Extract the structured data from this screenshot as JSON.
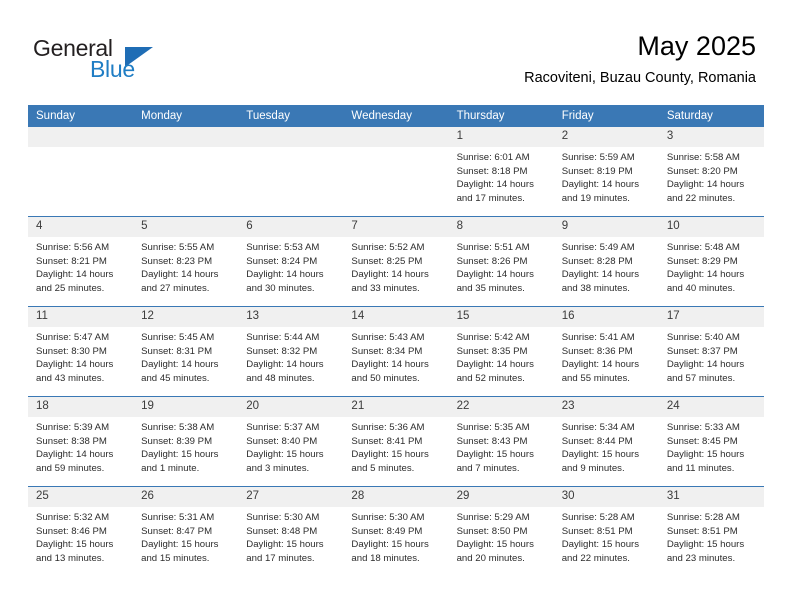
{
  "brand": {
    "name_top": "General",
    "name_bottom": "Blue",
    "accent_color": "#1f7dc4",
    "triangle_color": "#1f6db5"
  },
  "header": {
    "month_title": "May 2025",
    "location": "Racoviteni, Buzau County, Romania"
  },
  "calendar": {
    "header_bg": "#3a78b5",
    "header_text_color": "#ffffff",
    "daynum_bg": "#f0f0f0",
    "weekday_headers": [
      "Sunday",
      "Monday",
      "Tuesday",
      "Wednesday",
      "Thursday",
      "Friday",
      "Saturday"
    ],
    "weeks": [
      [
        {
          "day": "",
          "empty": true
        },
        {
          "day": "",
          "empty": true
        },
        {
          "day": "",
          "empty": true
        },
        {
          "day": "",
          "empty": true
        },
        {
          "day": "1",
          "sunrise": "Sunrise: 6:01 AM",
          "sunset": "Sunset: 8:18 PM",
          "daylight_line1": "Daylight: 14 hours",
          "daylight_line2": "and 17 minutes."
        },
        {
          "day": "2",
          "sunrise": "Sunrise: 5:59 AM",
          "sunset": "Sunset: 8:19 PM",
          "daylight_line1": "Daylight: 14 hours",
          "daylight_line2": "and 19 minutes."
        },
        {
          "day": "3",
          "sunrise": "Sunrise: 5:58 AM",
          "sunset": "Sunset: 8:20 PM",
          "daylight_line1": "Daylight: 14 hours",
          "daylight_line2": "and 22 minutes."
        }
      ],
      [
        {
          "day": "4",
          "sunrise": "Sunrise: 5:56 AM",
          "sunset": "Sunset: 8:21 PM",
          "daylight_line1": "Daylight: 14 hours",
          "daylight_line2": "and 25 minutes."
        },
        {
          "day": "5",
          "sunrise": "Sunrise: 5:55 AM",
          "sunset": "Sunset: 8:23 PM",
          "daylight_line1": "Daylight: 14 hours",
          "daylight_line2": "and 27 minutes."
        },
        {
          "day": "6",
          "sunrise": "Sunrise: 5:53 AM",
          "sunset": "Sunset: 8:24 PM",
          "daylight_line1": "Daylight: 14 hours",
          "daylight_line2": "and 30 minutes."
        },
        {
          "day": "7",
          "sunrise": "Sunrise: 5:52 AM",
          "sunset": "Sunset: 8:25 PM",
          "daylight_line1": "Daylight: 14 hours",
          "daylight_line2": "and 33 minutes."
        },
        {
          "day": "8",
          "sunrise": "Sunrise: 5:51 AM",
          "sunset": "Sunset: 8:26 PM",
          "daylight_line1": "Daylight: 14 hours",
          "daylight_line2": "and 35 minutes."
        },
        {
          "day": "9",
          "sunrise": "Sunrise: 5:49 AM",
          "sunset": "Sunset: 8:28 PM",
          "daylight_line1": "Daylight: 14 hours",
          "daylight_line2": "and 38 minutes."
        },
        {
          "day": "10",
          "sunrise": "Sunrise: 5:48 AM",
          "sunset": "Sunset: 8:29 PM",
          "daylight_line1": "Daylight: 14 hours",
          "daylight_line2": "and 40 minutes."
        }
      ],
      [
        {
          "day": "11",
          "sunrise": "Sunrise: 5:47 AM",
          "sunset": "Sunset: 8:30 PM",
          "daylight_line1": "Daylight: 14 hours",
          "daylight_line2": "and 43 minutes."
        },
        {
          "day": "12",
          "sunrise": "Sunrise: 5:45 AM",
          "sunset": "Sunset: 8:31 PM",
          "daylight_line1": "Daylight: 14 hours",
          "daylight_line2": "and 45 minutes."
        },
        {
          "day": "13",
          "sunrise": "Sunrise: 5:44 AM",
          "sunset": "Sunset: 8:32 PM",
          "daylight_line1": "Daylight: 14 hours",
          "daylight_line2": "and 48 minutes."
        },
        {
          "day": "14",
          "sunrise": "Sunrise: 5:43 AM",
          "sunset": "Sunset: 8:34 PM",
          "daylight_line1": "Daylight: 14 hours",
          "daylight_line2": "and 50 minutes."
        },
        {
          "day": "15",
          "sunrise": "Sunrise: 5:42 AM",
          "sunset": "Sunset: 8:35 PM",
          "daylight_line1": "Daylight: 14 hours",
          "daylight_line2": "and 52 minutes."
        },
        {
          "day": "16",
          "sunrise": "Sunrise: 5:41 AM",
          "sunset": "Sunset: 8:36 PM",
          "daylight_line1": "Daylight: 14 hours",
          "daylight_line2": "and 55 minutes."
        },
        {
          "day": "17",
          "sunrise": "Sunrise: 5:40 AM",
          "sunset": "Sunset: 8:37 PM",
          "daylight_line1": "Daylight: 14 hours",
          "daylight_line2": "and 57 minutes."
        }
      ],
      [
        {
          "day": "18",
          "sunrise": "Sunrise: 5:39 AM",
          "sunset": "Sunset: 8:38 PM",
          "daylight_line1": "Daylight: 14 hours",
          "daylight_line2": "and 59 minutes."
        },
        {
          "day": "19",
          "sunrise": "Sunrise: 5:38 AM",
          "sunset": "Sunset: 8:39 PM",
          "daylight_line1": "Daylight: 15 hours",
          "daylight_line2": "and 1 minute."
        },
        {
          "day": "20",
          "sunrise": "Sunrise: 5:37 AM",
          "sunset": "Sunset: 8:40 PM",
          "daylight_line1": "Daylight: 15 hours",
          "daylight_line2": "and 3 minutes."
        },
        {
          "day": "21",
          "sunrise": "Sunrise: 5:36 AM",
          "sunset": "Sunset: 8:41 PM",
          "daylight_line1": "Daylight: 15 hours",
          "daylight_line2": "and 5 minutes."
        },
        {
          "day": "22",
          "sunrise": "Sunrise: 5:35 AM",
          "sunset": "Sunset: 8:43 PM",
          "daylight_line1": "Daylight: 15 hours",
          "daylight_line2": "and 7 minutes."
        },
        {
          "day": "23",
          "sunrise": "Sunrise: 5:34 AM",
          "sunset": "Sunset: 8:44 PM",
          "daylight_line1": "Daylight: 15 hours",
          "daylight_line2": "and 9 minutes."
        },
        {
          "day": "24",
          "sunrise": "Sunrise: 5:33 AM",
          "sunset": "Sunset: 8:45 PM",
          "daylight_line1": "Daylight: 15 hours",
          "daylight_line2": "and 11 minutes."
        }
      ],
      [
        {
          "day": "25",
          "sunrise": "Sunrise: 5:32 AM",
          "sunset": "Sunset: 8:46 PM",
          "daylight_line1": "Daylight: 15 hours",
          "daylight_line2": "and 13 minutes."
        },
        {
          "day": "26",
          "sunrise": "Sunrise: 5:31 AM",
          "sunset": "Sunset: 8:47 PM",
          "daylight_line1": "Daylight: 15 hours",
          "daylight_line2": "and 15 minutes."
        },
        {
          "day": "27",
          "sunrise": "Sunrise: 5:30 AM",
          "sunset": "Sunset: 8:48 PM",
          "daylight_line1": "Daylight: 15 hours",
          "daylight_line2": "and 17 minutes."
        },
        {
          "day": "28",
          "sunrise": "Sunrise: 5:30 AM",
          "sunset": "Sunset: 8:49 PM",
          "daylight_line1": "Daylight: 15 hours",
          "daylight_line2": "and 18 minutes."
        },
        {
          "day": "29",
          "sunrise": "Sunrise: 5:29 AM",
          "sunset": "Sunset: 8:50 PM",
          "daylight_line1": "Daylight: 15 hours",
          "daylight_line2": "and 20 minutes."
        },
        {
          "day": "30",
          "sunrise": "Sunrise: 5:28 AM",
          "sunset": "Sunset: 8:51 PM",
          "daylight_line1": "Daylight: 15 hours",
          "daylight_line2": "and 22 minutes."
        },
        {
          "day": "31",
          "sunrise": "Sunrise: 5:28 AM",
          "sunset": "Sunset: 8:51 PM",
          "daylight_line1": "Daylight: 15 hours",
          "daylight_line2": "and 23 minutes."
        }
      ]
    ]
  }
}
